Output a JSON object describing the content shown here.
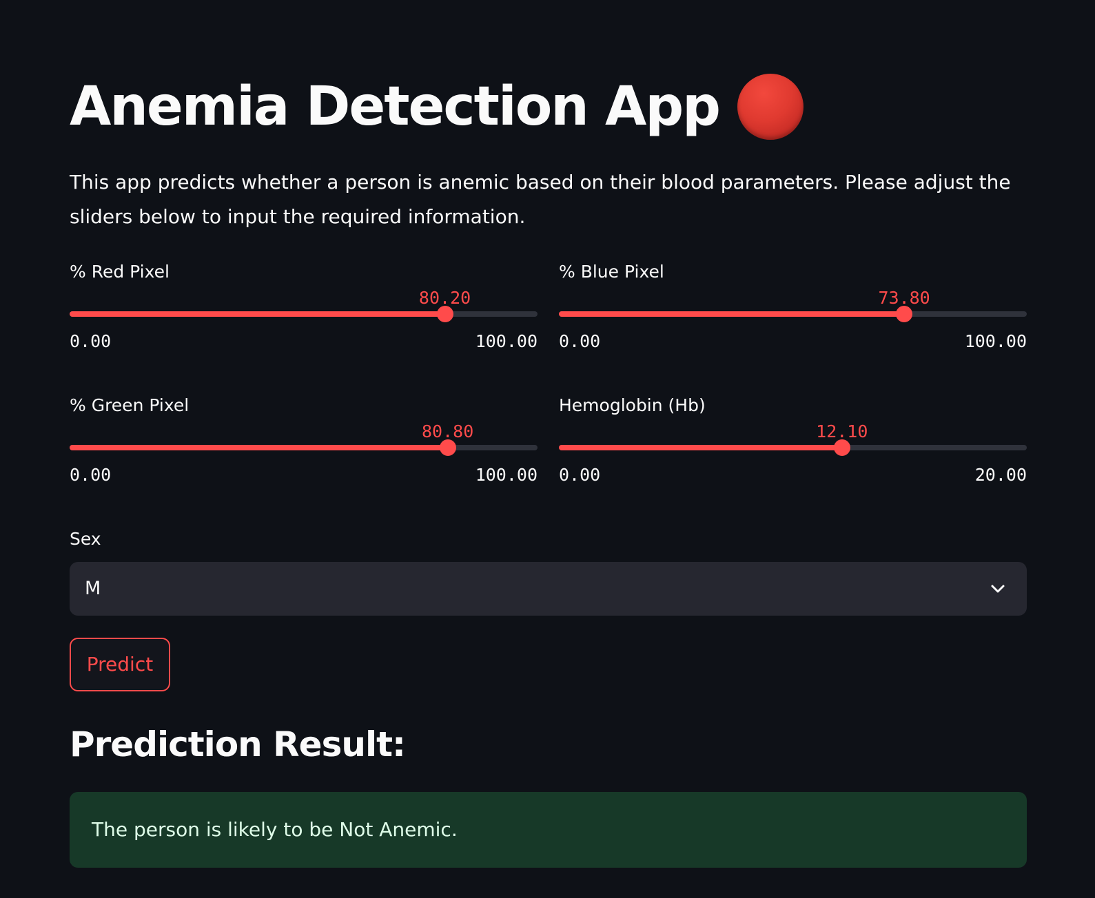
{
  "header": {
    "title": "Anemia Detection App",
    "title_icon": "red-circle-emoji"
  },
  "intro": {
    "text": "This app predicts whether a person is anemic based on their blood parameters. Please adjust the sliders below to input the required information."
  },
  "sliders": {
    "red_pixel": {
      "label": "% Red Pixel",
      "value": "80.20",
      "min": "0.00",
      "max": "100.00",
      "fraction": 0.802
    },
    "blue_pixel": {
      "label": "% Blue Pixel",
      "value": "73.80",
      "min": "0.00",
      "max": "100.00",
      "fraction": 0.738
    },
    "green_pixel": {
      "label": "% Green Pixel",
      "value": "80.80",
      "min": "0.00",
      "max": "100.00",
      "fraction": 0.808
    },
    "hemoglobin": {
      "label": "Hemoglobin (Hb)",
      "value": "12.10",
      "min": "0.00",
      "max": "20.00",
      "fraction": 0.605
    }
  },
  "sex": {
    "label": "Sex",
    "selected": "M",
    "icon": "chevron-down-icon"
  },
  "predict": {
    "label": "Predict"
  },
  "result": {
    "heading": "Prediction Result:",
    "message": "The person is likely to be Not Anemic."
  },
  "colors": {
    "background": "#0e1117",
    "accent": "#ff4b4b",
    "track": "#2f323b",
    "select_bg": "#262730",
    "success_bg": "#173928",
    "success_text": "#dffde9"
  }
}
